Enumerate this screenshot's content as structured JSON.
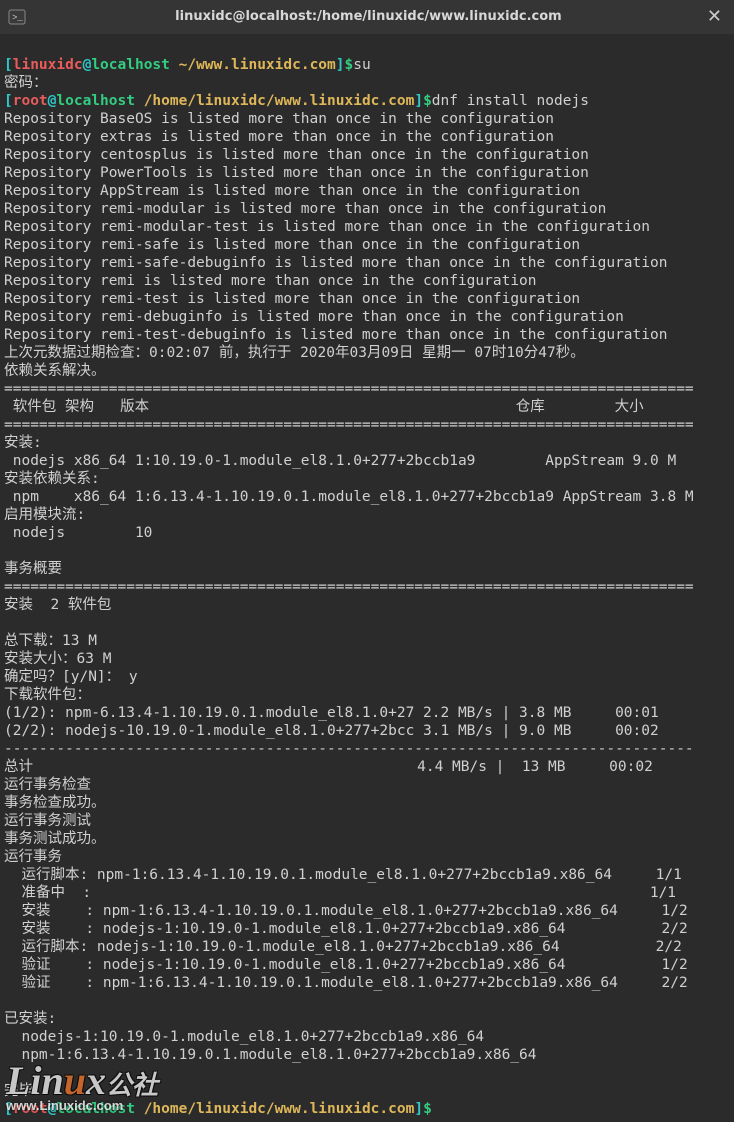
{
  "window": {
    "title": "linuxidc@localhost:/home/linuxidc/www.linuxidc.com",
    "close_glyph": "✕"
  },
  "prompt1": {
    "open": "[",
    "user": "linuxidc",
    "at": "@",
    "host": "localhost",
    "path": " ~/www.linuxidc.com",
    "close": "]",
    "dollar": "$",
    "cmd": "su"
  },
  "pwdline": "密码：",
  "prompt2": {
    "open": "[",
    "user": "root",
    "at": "@",
    "host": "localhost",
    "path": " /home/linuxidc/www.linuxidc.com",
    "close": "]",
    "dollar": "$",
    "cmd": "dnf install nodejs"
  },
  "repos": [
    "Repository BaseOS is listed more than once in the configuration",
    "Repository extras is listed more than once in the configuration",
    "Repository centosplus is listed more than once in the configuration",
    "Repository PowerTools is listed more than once in the configuration",
    "Repository AppStream is listed more than once in the configuration",
    "Repository remi-modular is listed more than once in the configuration",
    "Repository remi-modular-test is listed more than once in the configuration",
    "Repository remi-safe is listed more than once in the configuration",
    "Repository remi-safe-debuginfo is listed more than once in the configuration",
    "Repository remi is listed more than once in the configuration",
    "Repository remi-test is listed more than once in the configuration",
    "Repository remi-debuginfo is listed more than once in the configuration",
    "Repository remi-test-debuginfo is listed more than once in the configuration"
  ],
  "meta_check": "上次元数据过期检查：0:02:07 前，执行于 2020年03月09日 星期一 07时10分47秒。",
  "dep_resolved": "依赖关系解决。",
  "hr": "===============================================================================",
  "dashline": "-------------------------------------------------------------------------------",
  "headers": " 软件包 架构   版本                                          仓库        大小",
  "section_install": "安装:",
  "pkg1": " nodejs x86_64 1:10.19.0-1.module_el8.1.0+277+2bccb1a9        AppStream 9.0 M",
  "section_deps": "安装依赖关系:",
  "pkg2": " npm    x86_64 1:6.13.4-1.10.19.0.1.module_el8.1.0+277+2bccb1a9 AppStream 3.8 M",
  "section_stream": "启用模块流:",
  "pkg3": " nodejs        10",
  "summary_title": "事务概要",
  "summary_install": "安装  2 软件包",
  "total_dl": "总下载：13 M",
  "install_size": "安装大小：63 M",
  "confirm": "确定吗？[y/N]： y",
  "dl_header": "下载软件包：",
  "dl1": "(1/2): npm-6.13.4-1.10.19.0.1.module_el8.1.0+27 2.2 MB/s | 3.8 MB     00:01",
  "dl2": "(2/2): nodejs-10.19.0-1.module_el8.1.0+277+2bcc 3.1 MB/s | 9.0 MB     00:02",
  "total": "总计                                            4.4 MB/s |  13 MB     00:02",
  "run_check": "运行事务检查",
  "check_ok": "事务检查成功。",
  "run_test": "运行事务测试",
  "test_ok": "事务测试成功。",
  "run_txn": "运行事务",
  "txn": [
    "  运行脚本: npm-1:6.13.4-1.10.19.0.1.module_el8.1.0+277+2bccb1a9.x86_64     1/1",
    "  准备中  :                                                                1/1",
    "  安装    : npm-1:6.13.4-1.10.19.0.1.module_el8.1.0+277+2bccb1a9.x86_64     1/2",
    "  安装    : nodejs-1:10.19.0-1.module_el8.1.0+277+2bccb1a9.x86_64           2/2",
    "  运行脚本: nodejs-1:10.19.0-1.module_el8.1.0+277+2bccb1a9.x86_64           2/2",
    "  验证    : nodejs-1:10.19.0-1.module_el8.1.0+277+2bccb1a9.x86_64           1/2",
    "  验证    : npm-1:6.13.4-1.10.19.0.1.module_el8.1.0+277+2bccb1a9.x86_64     2/2"
  ],
  "installed_header": "已安装:",
  "installed": [
    "  nodejs-1:10.19.0-1.module_el8.1.0+277+2bccb1a9.x86_64",
    "  npm-1:6.13.4-1.10.19.0.1.module_el8.1.0+277+2bccb1a9.x86_64"
  ],
  "done": "完毕！",
  "prompt3": {
    "open": "[",
    "user": "root",
    "at": "@",
    "host": "localhost",
    "path": " /home/linuxidc/www.linuxidc.com",
    "close": "]",
    "dollar": "$",
    "cmd": ""
  },
  "watermark": {
    "brand_a": "Lin",
    "brand_b": "u",
    "brand_c": "x",
    "suffix": "公社",
    "url": "www.Linuxidc.com"
  }
}
